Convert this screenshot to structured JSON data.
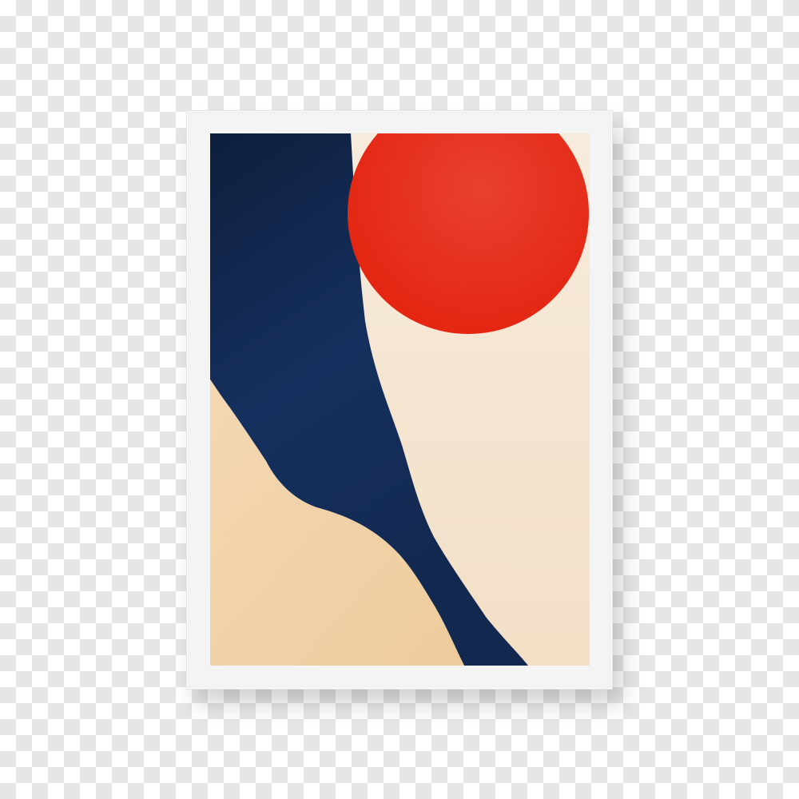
{
  "scene": {
    "background": "transparency-checkerboard",
    "checker_colors": [
      "#ffffff",
      "#e6e6e6"
    ]
  },
  "frame": {
    "color": "#f4f4f4",
    "style": "white-picture-frame"
  },
  "artwork": {
    "style": "abstract-minimal",
    "colors": {
      "cream": "#f5e6d0",
      "sand": "#f0d2a8",
      "navy": "#14305c",
      "red": "#e8301e"
    },
    "shapes": [
      "red-sun-circle",
      "navy-river-band",
      "sand-hill",
      "cream-field"
    ]
  }
}
